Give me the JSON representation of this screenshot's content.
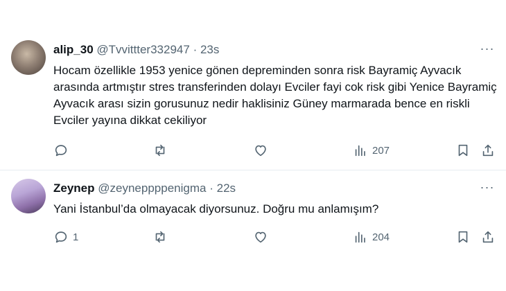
{
  "tweets": [
    {
      "name": "alip_30",
      "handle": "@Tvvittter332947",
      "separator": "·",
      "time": "23s",
      "text": "Hocam özellikle 1953 yenice gönen depreminden sonra risk Bayramiç Ayvacık arasında artmıştır stres transferinden dolayı Evciler fayi cok risk gibi Yenice Bayramiç Ayvacık arası sizin gorusunuz nedir haklisiniz Güney marmarada bence en riskli Evciler yayına dikkat cekiliyor",
      "reply_count": "",
      "retweet_count": "",
      "like_count": "",
      "view_count": "207",
      "more_label": "···"
    },
    {
      "name": "Zeynep",
      "handle": "@zeyneppppenigma",
      "separator": "·",
      "time": "22s",
      "text": "Yani İstanbul’da olmayacak diyorsunuz. Doğru mu anlamışım?",
      "reply_count": "1",
      "retweet_count": "",
      "like_count": "",
      "view_count": "204",
      "more_label": "···"
    }
  ]
}
